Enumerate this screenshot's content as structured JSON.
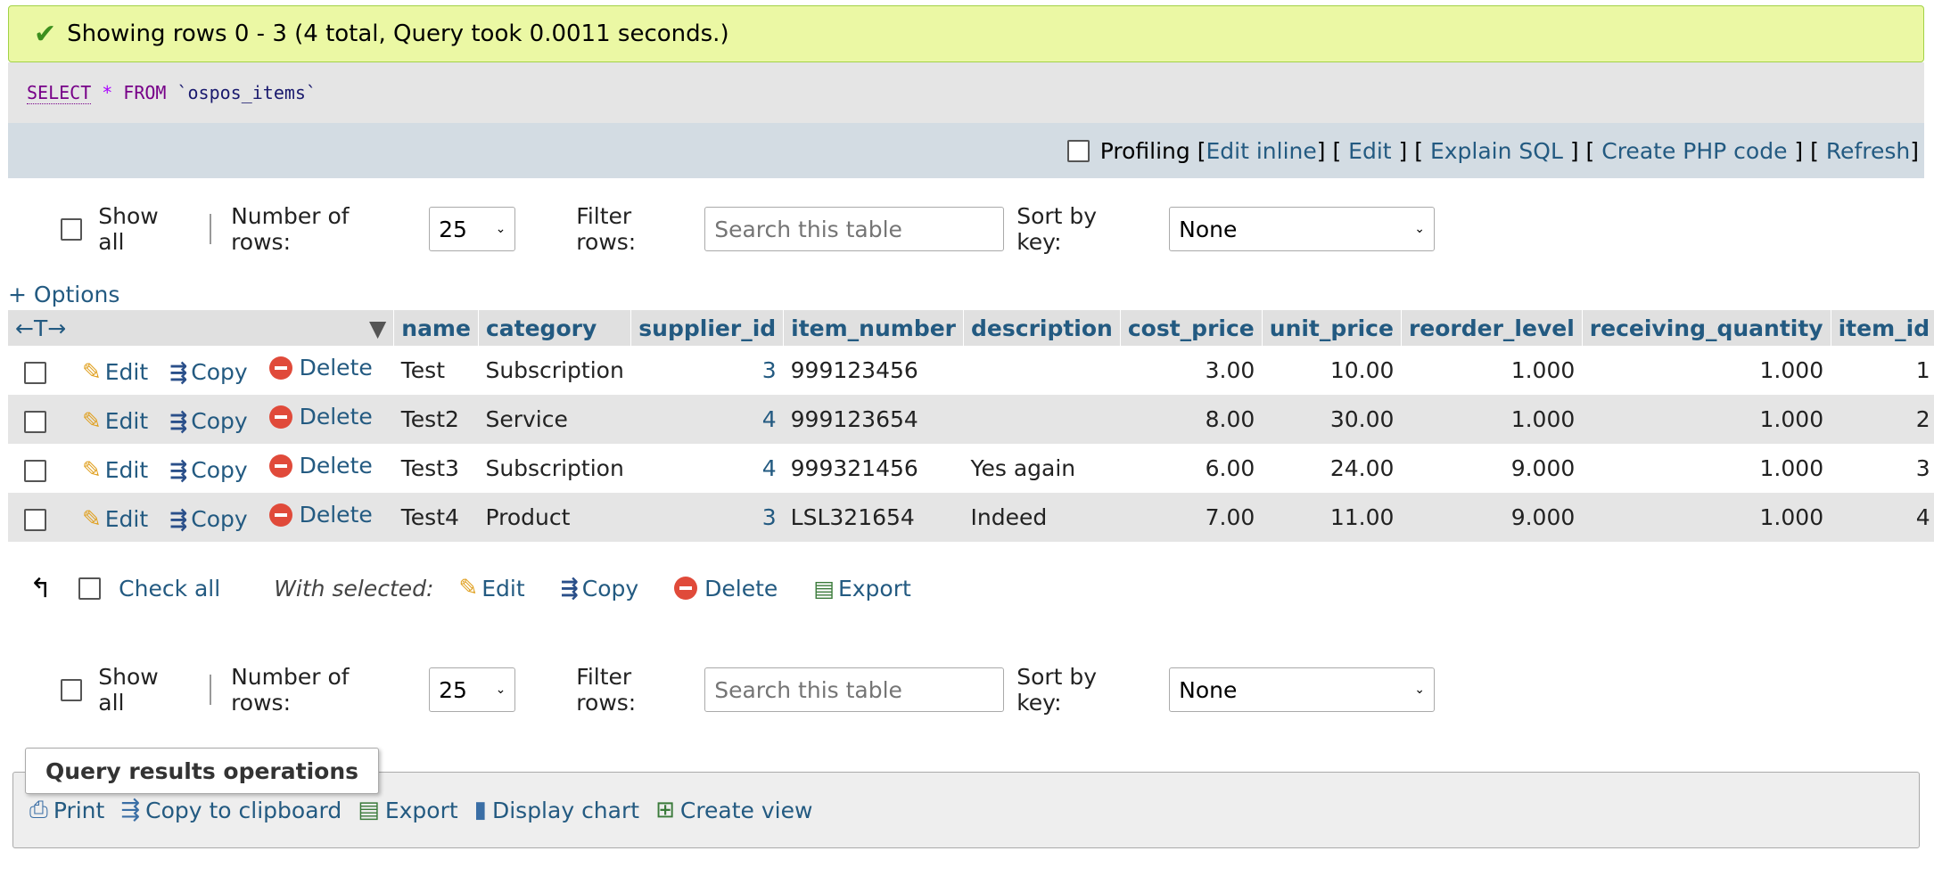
{
  "message": {
    "text": "Showing rows 0 - 3 (4 total, Query took 0.0011 seconds.)"
  },
  "sql": {
    "keyword": "SELECT",
    "star": "*",
    "from": "FROM",
    "table": "`ospos_items`"
  },
  "tools": {
    "profiling": "Profiling",
    "edit_inline": "Edit inline",
    "edit": "Edit",
    "explain": "Explain SQL",
    "php": "Create PHP code",
    "refresh": "Refresh"
  },
  "nav": {
    "show_all": "Show all",
    "rows_label": "Number of rows:",
    "rows_value": "25",
    "filter_label": "Filter rows:",
    "filter_placeholder": "Search this table",
    "sort_label": "Sort by key:",
    "sort_value": "None"
  },
  "options_link": "+ Options",
  "table": {
    "columns": [
      "name",
      "category",
      "supplier_id",
      "item_number",
      "description",
      "cost_price",
      "unit_price",
      "reorder_level",
      "receiving_quantity",
      "item_id"
    ],
    "actions": {
      "edit": "Edit",
      "copy": "Copy",
      "delete": "Delete"
    },
    "rows": [
      [
        "Test",
        "Subscription",
        "3",
        "999123456",
        "",
        "3.00",
        "10.00",
        "1.000",
        "1.000",
        "1"
      ],
      [
        "Test2",
        "Service",
        "4",
        "999123654",
        "",
        "8.00",
        "30.00",
        "1.000",
        "1.000",
        "2"
      ],
      [
        "Test3",
        "Subscription",
        "4",
        "999321456",
        "Yes again",
        "6.00",
        "24.00",
        "9.000",
        "1.000",
        "3"
      ],
      [
        "Test4",
        "Product",
        "3",
        "LSL321654",
        "Indeed",
        "7.00",
        "11.00",
        "9.000",
        "1.000",
        "4"
      ]
    ]
  },
  "with_selected": {
    "check_all": "Check all",
    "label": "With selected:",
    "edit": "Edit",
    "copy": "Copy",
    "delete": "Delete",
    "export": "Export"
  },
  "qro": {
    "title": "Query results operations",
    "print": "Print",
    "copy": "Copy to clipboard",
    "export": "Export",
    "chart": "Display chart",
    "view": "Create view"
  }
}
